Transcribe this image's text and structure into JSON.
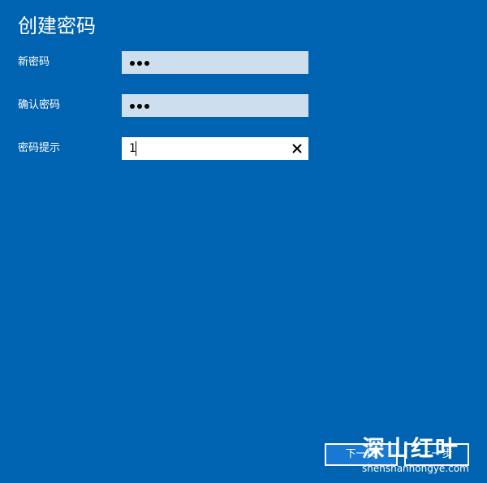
{
  "page": {
    "title": "创建密码"
  },
  "form": {
    "new_password": {
      "label": "新密码",
      "masked_length": 3
    },
    "confirm_password": {
      "label": "确认密码",
      "masked_length": 3
    },
    "password_hint": {
      "label": "密码提示",
      "value": "1",
      "clear_icon": "close-icon"
    }
  },
  "buttons": {
    "next_label": "下一页",
    "back_label": "上一步"
  },
  "watermark": {
    "brand": "深山红叶",
    "url": "shenshanhongye.com"
  },
  "colors": {
    "background": "#0063b1",
    "masked_field": "#cddfee",
    "active_field": "#ffffff",
    "button_fill": "#1879d2",
    "text": "#ffffff"
  }
}
